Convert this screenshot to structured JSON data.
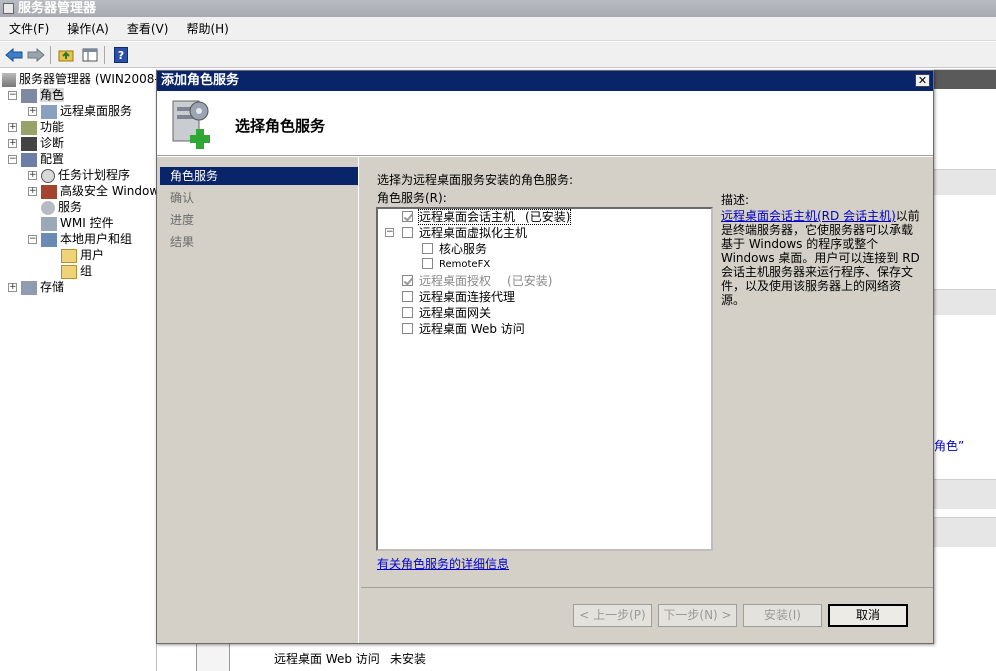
{
  "window": {
    "title": "服务器管理器"
  },
  "menu": [
    "文件(F)",
    "操作(A)",
    "查看(V)",
    "帮助(H)"
  ],
  "tree": {
    "root": "服务器管理器 (WIN2008-",
    "roles": "角色",
    "rds": "远程桌面服务",
    "features": "功能",
    "diagnostics": "诊断",
    "config": "配置",
    "tasks": "任务计划程序",
    "firewall": "高级安全 Window",
    "services": "服务",
    "wmi": "WMI 控件",
    "localusers": "本地用户和组",
    "users": "用户",
    "groups": "组",
    "storage": "存储"
  },
  "dialog": {
    "title": "添加角色服务",
    "header": "选择角色服务",
    "nav": [
      "角色服务",
      "确认",
      "进度",
      "结果"
    ],
    "prompt": "选择为远程桌面服务安装的角色服务:",
    "services_label": "角色服务(R):",
    "services": [
      {
        "name": "远程桌面会话主机",
        "status": "(已安装)"
      },
      {
        "name": "远程桌面虚拟化主机",
        "status": ""
      },
      {
        "name": "核心服务",
        "status": ""
      },
      {
        "name": "RemoteFX",
        "status": ""
      },
      {
        "name": "远程桌面授权",
        "status": "(已安装)"
      },
      {
        "name": "远程桌面连接代理",
        "status": ""
      },
      {
        "name": "远程桌面网关",
        "status": ""
      },
      {
        "name": "远程桌面 Web 访问",
        "status": ""
      }
    ],
    "desc_label": "描述:",
    "desc_link": "远程桌面会话主机(RD 会话主机)",
    "desc_text": "以前是终端服务器，它使服务器可以承载基于 Windows 的程序或整个 Windows 桌面。用户可以连接到 RD 会话主机服务器来运行程序、保存文件，以及使用该服务器上的网络资源。",
    "more_link": "有关角色服务的详细信息",
    "buttons": {
      "prev": "< 上一步(P)",
      "next": "下一步(N) >",
      "install": "安装(I)",
      "cancel": "取消"
    }
  },
  "background": {
    "bottom_row_name": "远程桌面 Web 访问",
    "bottom_row_status": "未安装",
    "right_fragment": "角色”"
  }
}
